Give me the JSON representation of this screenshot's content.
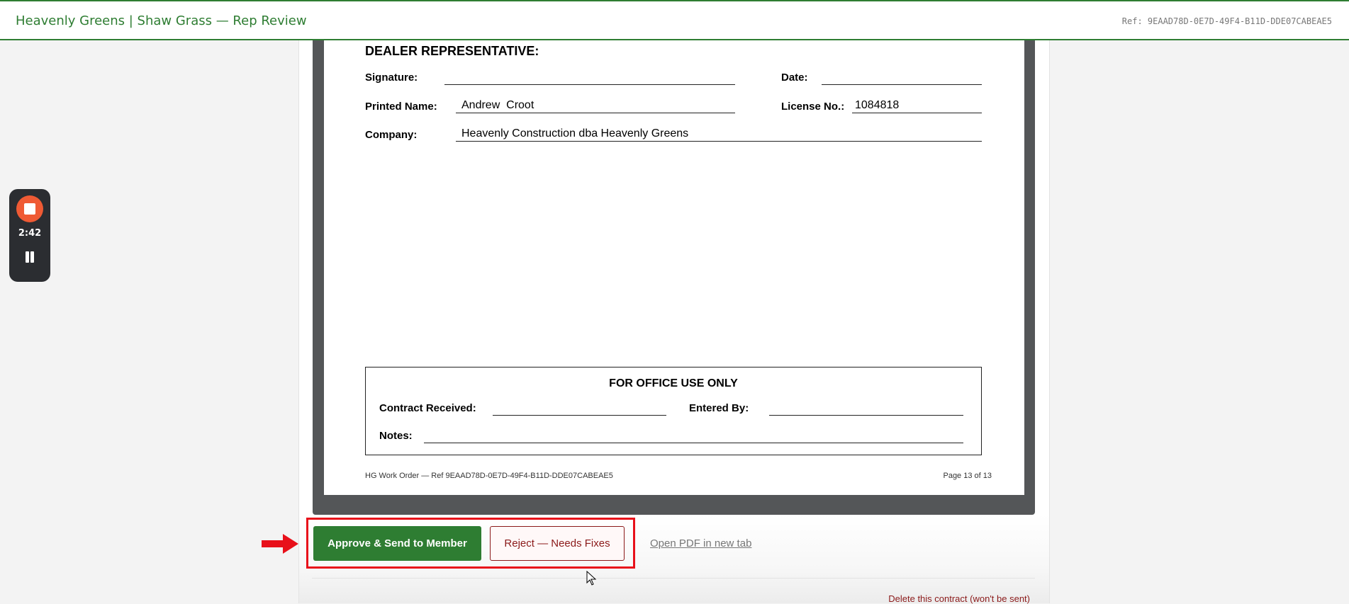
{
  "header": {
    "title": "Heavenly Greens | Shaw Grass — Rep Review",
    "ref": "Ref: 9EAAD78D-0E7D-49F4-B11D-DDE07CABEAE5"
  },
  "recorder": {
    "time": "2:42",
    "stop_icon": "stop-icon",
    "pause_icon": "pause-icon"
  },
  "document": {
    "section_heading": "DEALER REPRESENTATIVE:",
    "signature_label": "Signature:",
    "date_label": "Date:",
    "printed_name_label": "Printed Name:",
    "printed_name_value": "Andrew  Croot",
    "license_label": "License No.:",
    "license_value": "1084818",
    "company_label": "Company:",
    "company_value": "Heavenly Construction dba Heavenly Greens",
    "office": {
      "title": "FOR OFFICE USE ONLY",
      "contract_received_label": "Contract Received:",
      "entered_by_label": "Entered By:",
      "notes_label": "Notes:"
    },
    "footer_left": "HG Work Order — Ref 9EAAD78D-0E7D-49F4-B11D-DDE07CABEAE5",
    "footer_right": "Page 13 of 13"
  },
  "actions": {
    "approve_label": "Approve & Send to Member",
    "reject_label": "Reject — Needs Fixes",
    "open_pdf_label": "Open PDF in new tab",
    "delete_label": "Delete this contract (won't be sent)"
  },
  "colors": {
    "brand_green": "#2e7d32",
    "reject_red": "#8b1a1a",
    "annotation_red": "#e8101a",
    "recorder_bg": "#2b2d31",
    "recorder_stop": "#ef5a34"
  }
}
